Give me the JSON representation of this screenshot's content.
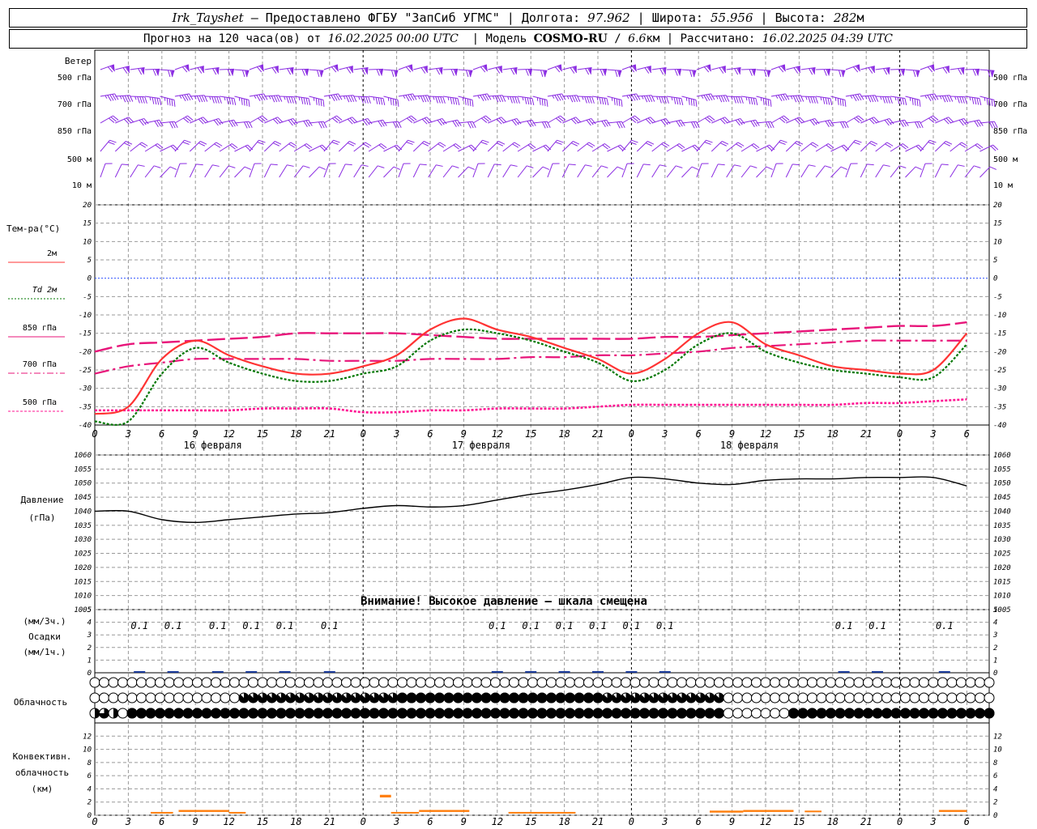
{
  "header": {
    "station": "Irk_Tayshet",
    "provider": "— Предоставлено ФГБУ \"ЗапСиб УГМС\"",
    "lon_label": "Долгота:",
    "lon": "97.962",
    "lat_label": "Широта:",
    "lat": "55.956",
    "alt_label": "Высота:",
    "alt": "282",
    "alt_unit": "м",
    "forecast_label": "Прогноз на 120 часа(ов) от",
    "forecast_start": "16.02.2025 00:00 UTC",
    "model_label": "Модель",
    "model_name": "COSMO-RU",
    "model_res": "6.6",
    "model_res_unit": "км",
    "computed_label": "Рассчитано:",
    "computed_time": "16.02.2025 04:39 UTC"
  },
  "colors": {
    "wind": "#8a2be2",
    "t2m": "#ff3333",
    "td2m": "#007700",
    "t850": "#e8157a",
    "t700": "#e8157a",
    "t500": "#ff1493",
    "zero_line": "#3355ff",
    "pressure": "#000000",
    "precip": "#1a3a9a",
    "convective": "#ff7f0e",
    "grid": "#999999"
  },
  "chart_data": [
    {
      "type": "wind_barbs",
      "title": "Ветер",
      "levels": [
        "500 гПа",
        "700 гПа",
        "850 гПа",
        "500 м",
        "10 м"
      ],
      "level_speeds_kt": [
        70,
        45,
        30,
        20,
        12
      ],
      "level_dirs_deg": [
        250,
        260,
        240,
        220,
        200
      ]
    },
    {
      "type": "line",
      "title": "Тем-ра(°С)",
      "ylim": [
        -40,
        20
      ],
      "yticks": [
        20,
        15,
        10,
        5,
        0,
        -5,
        -10,
        -15,
        -20,
        -25,
        -30,
        -35,
        -40
      ],
      "x_hours": [
        0,
        3,
        6,
        9,
        12,
        15,
        18,
        21,
        24,
        27,
        30,
        33,
        36,
        39,
        42,
        45,
        48,
        51,
        54,
        57,
        60,
        63,
        66,
        69,
        72,
        75,
        78
      ],
      "x_tick_labels": [
        "0",
        "3",
        "6",
        "9",
        "12",
        "15",
        "18",
        "21",
        "0",
        "3",
        "6",
        "9",
        "12",
        "15",
        "18",
        "21",
        "0",
        "3",
        "6",
        "9",
        "12",
        "15",
        "18",
        "21",
        "0",
        "3",
        "6"
      ],
      "day_labels": [
        "16 февраля",
        "17 февраля",
        "18 февраля"
      ],
      "series": [
        {
          "name": "2м",
          "style": "solid",
          "values": [
            -37,
            -35,
            -22,
            -17,
            -21,
            -24,
            -26,
            -26,
            -24,
            -21,
            -14,
            -11,
            -14,
            -16,
            -19,
            -22,
            -26,
            -22,
            -15,
            -12,
            -18,
            -21,
            -24,
            -25,
            -26,
            -25,
            -15
          ]
        },
        {
          "name": "Td 2м",
          "style": "dotted",
          "values": [
            -39,
            -39,
            -26,
            -19,
            -23,
            -26,
            -28,
            -28,
            -26,
            -24,
            -17,
            -14,
            -15,
            -17,
            -20,
            -23,
            -28,
            -25,
            -18,
            -15,
            -20,
            -23,
            -25,
            -26,
            -27,
            -27,
            -18
          ]
        },
        {
          "name": "850 гПа",
          "style": "longdash",
          "values": [
            -20,
            -18,
            -17.5,
            -17,
            -16.5,
            -16,
            -15,
            -15,
            -15,
            -15,
            -15.5,
            -16,
            -16.5,
            -16.5,
            -16.5,
            -16.5,
            -16.5,
            -16,
            -16,
            -15.5,
            -15,
            -14.5,
            -14,
            -13.5,
            -13,
            -13,
            -12
          ]
        },
        {
          "name": "700 гПа",
          "style": "dashdot",
          "values": [
            -26,
            -24,
            -23,
            -22,
            -22,
            -22,
            -22,
            -22.5,
            -22.5,
            -22.5,
            -22,
            -22,
            -22,
            -21.5,
            -21.5,
            -21,
            -21,
            -20.5,
            -20,
            -19,
            -18.5,
            -18,
            -17.5,
            -17,
            -17,
            -17,
            -17
          ]
        },
        {
          "name": "500 гПа",
          "style": "dotted",
          "values": [
            -36,
            -36,
            -36,
            -36,
            -36,
            -35.5,
            -35.5,
            -35.5,
            -36.5,
            -36.5,
            -36,
            -36,
            -35.5,
            -35.5,
            -35.5,
            -35,
            -34.5,
            -34.5,
            -34.5,
            -34.5,
            -34.5,
            -34.5,
            -34.5,
            -34,
            -34,
            -33.5,
            -33
          ]
        }
      ]
    },
    {
      "type": "line",
      "title": "Давление (гПа)",
      "ylim": [
        1005,
        1060
      ],
      "yticks": [
        1060,
        1055,
        1050,
        1045,
        1040,
        1035,
        1030,
        1025,
        1020,
        1015,
        1010,
        1005
      ],
      "annotation": "Внимание! Высокое давление — шкала смещена",
      "series": [
        {
          "name": "Давление",
          "values": [
            1040,
            1040,
            1037,
            1036,
            1037,
            1038,
            1039,
            1039.5,
            1041,
            1042,
            1041.5,
            1042,
            1044,
            1046,
            1047.5,
            1049.5,
            1052,
            1051.5,
            1050,
            1049.5,
            1051,
            1051.5,
            1051.5,
            1052,
            1052,
            1052,
            1049
          ]
        }
      ]
    },
    {
      "type": "bar",
      "title": "(мм/3ч.) Осадки (мм/1ч.)",
      "ylim": [
        0,
        5
      ],
      "yticks": [
        5,
        4,
        3,
        2,
        1,
        0
      ],
      "label_hours": [
        4,
        7,
        11,
        14,
        17,
        21,
        36,
        39,
        42,
        45,
        48,
        51,
        67,
        70,
        76
      ],
      "labels": [
        "0.1",
        "0.1",
        "0.1",
        "0.1",
        "0.1",
        "0.1",
        "0.1",
        "0.1",
        "0.1",
        "0.1",
        "0.1",
        "0.1",
        "0.1",
        "0.1",
        "0.1"
      ],
      "values_mm_per_3h": [
        0.1,
        0.1,
        0.1,
        0.1,
        0.1,
        0.1,
        0.1,
        0.1,
        0.1,
        0.1,
        0.1,
        0.1,
        0.1,
        0.1,
        0.1
      ]
    },
    {
      "type": "table",
      "title": "Облачность",
      "rows_cover_fraction": [
        "0000000000000000000000000000000000000000000000000000000000000000000000000000000000000000000000000",
        "0000000000000000888888888888888889999999999999999999999888888888888800000000000000000000000000000",
        "5750999999999999999999999999999999999999999999999999999999999999999900000009999999999999999999999"
      ]
    },
    {
      "type": "bar",
      "title": "Конвективн. облачность (км)",
      "ylim": [
        0,
        14
      ],
      "yticks": [
        12,
        10,
        8,
        6,
        4,
        2,
        0
      ],
      "segments": [
        {
          "start_h": 5,
          "end_h": 7,
          "base": 0.3,
          "top": 0.5
        },
        {
          "start_h": 7.5,
          "end_h": 12,
          "base": 0.5,
          "top": 0.8
        },
        {
          "start_h": 12,
          "end_h": 13.5,
          "base": 0.3,
          "top": 0.5
        },
        {
          "start_h": 25.5,
          "end_h": 26.5,
          "base": 2.7,
          "top": 3.1
        },
        {
          "start_h": 26.5,
          "end_h": 29,
          "base": 0.3,
          "top": 0.5
        },
        {
          "start_h": 29,
          "end_h": 33.5,
          "base": 0.5,
          "top": 0.8
        },
        {
          "start_h": 37,
          "end_h": 43,
          "base": 0.3,
          "top": 0.5
        },
        {
          "start_h": 55,
          "end_h": 58,
          "base": 0.4,
          "top": 0.7
        },
        {
          "start_h": 58,
          "end_h": 62.5,
          "base": 0.5,
          "top": 0.8
        },
        {
          "start_h": 63.5,
          "end_h": 65,
          "base": 0.5,
          "top": 0.7
        },
        {
          "start_h": 75.5,
          "end_h": 78,
          "base": 0.5,
          "top": 0.8
        }
      ]
    }
  ],
  "panels": {
    "wind_label": "Ветер",
    "temp_label": "Тем-ра(°С)",
    "pressure_label_1": "Давление",
    "pressure_label_2": "(гПа)",
    "precip_label_1": "(мм/3ч.)",
    "precip_label_2": "Осадки",
    "precip_label_3": "(мм/1ч.)",
    "cloud_label": "Облачность",
    "conv_label_1": "Конвективн.",
    "conv_label_2": "облачность",
    "conv_label_3": "(км)"
  }
}
